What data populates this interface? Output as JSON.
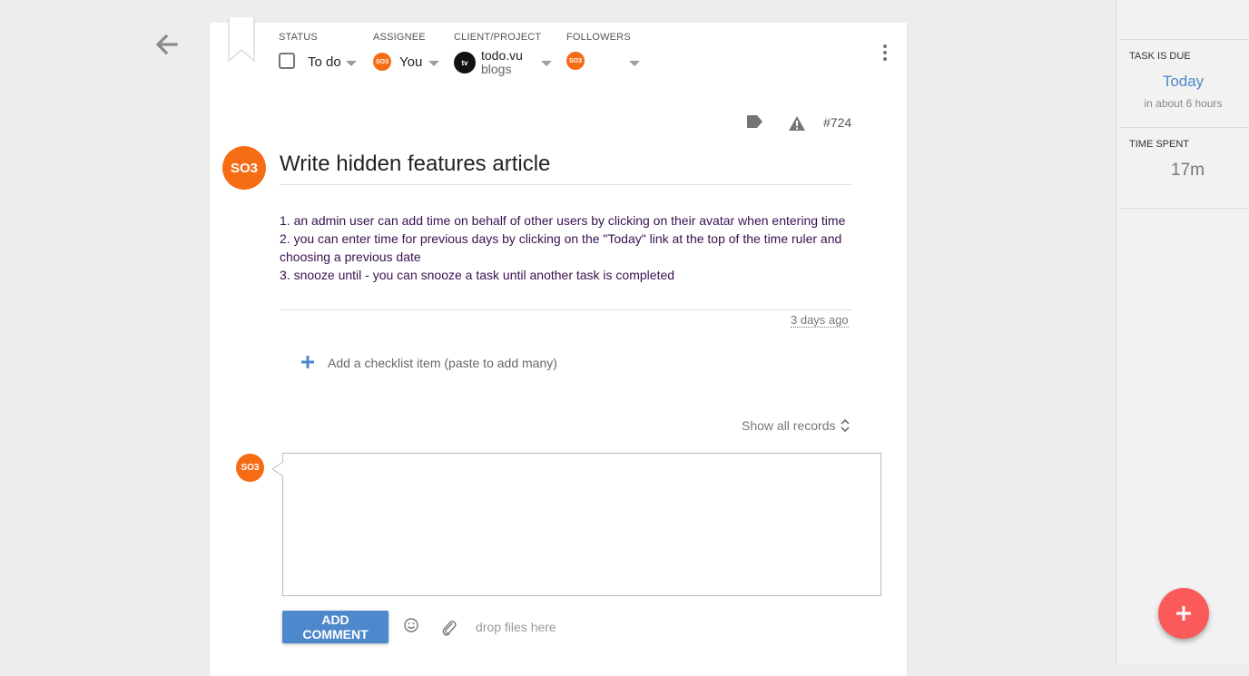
{
  "header": {
    "status_label": "STATUS",
    "status_value": "To do",
    "assignee_label": "ASSIGNEE",
    "assignee_avatar": "SO3",
    "assignee_value": "You",
    "client_label": "CLIENT/PROJECT",
    "client_logo": "tv",
    "client_name": "todo.vu",
    "project_name": "blogs",
    "followers_label": "FOLLOWERS",
    "follower_avatar": "SO3"
  },
  "task": {
    "id": "#724",
    "owner_avatar": "SO3",
    "title": "Write hidden features article",
    "description": [
      "1. an admin user can add time on behalf of other users by clicking on their avatar when entering time",
      "2. you can enter time for previous days by clicking on the \"Today\" link at the top of the time ruler and choosing a previous date",
      "3. snooze until - you can snooze a task until another task is completed"
    ],
    "timestamp": "3 days ago"
  },
  "checklist": {
    "placeholder": "Add a checklist item (paste to add many)"
  },
  "records": {
    "show_all_label": "Show all records"
  },
  "comment": {
    "avatar": "SO3",
    "button_label": "ADD COMMENT",
    "drop_text": "drop files here"
  },
  "sidebar": {
    "due_label": "TASK IS DUE",
    "due_value": "Today",
    "due_sub": "in about 6 hours",
    "time_label": "TIME SPENT",
    "time_value": "17m"
  },
  "colors": {
    "accent": "#4e88cc",
    "avatar": "#f56c15",
    "fab": "#fa5a5a",
    "description_text": "#3a1150"
  }
}
